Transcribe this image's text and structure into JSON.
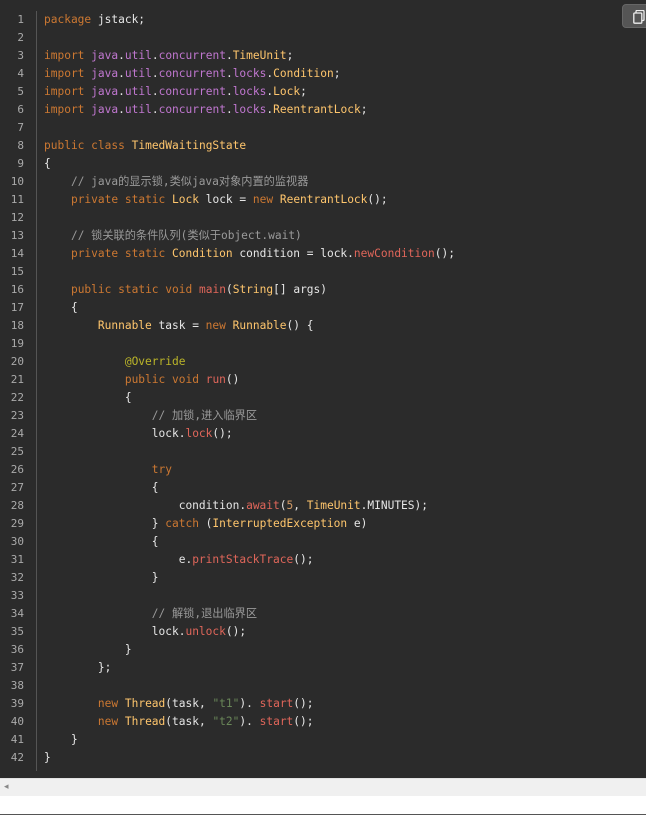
{
  "toolbar": {
    "copy_icon": "copy-icon"
  },
  "code_block": {
    "language": "java",
    "line_numbers": [
      "1",
      "2",
      "3",
      "4",
      "5",
      "6",
      "7",
      "8",
      "9",
      "10",
      "11",
      "12",
      "13",
      "14",
      "15",
      "16",
      "17",
      "18",
      "19",
      "20",
      "21",
      "22",
      "23",
      "24",
      "25",
      "26",
      "27",
      "28",
      "29",
      "30",
      "31",
      "32",
      "33",
      "34",
      "35",
      "36",
      "37",
      "38",
      "39",
      "40",
      "41",
      "42"
    ],
    "lines": [
      [
        [
          "kw",
          "package"
        ],
        [
          "plain",
          " jstack;"
        ]
      ],
      [],
      [
        [
          "kw",
          "import"
        ],
        [
          "plain",
          " "
        ],
        [
          "pkg",
          "java"
        ],
        [
          "plain",
          "."
        ],
        [
          "pkg",
          "util"
        ],
        [
          "plain",
          "."
        ],
        [
          "pkg",
          "concurrent"
        ],
        [
          "plain",
          "."
        ],
        [
          "cls",
          "TimeUnit"
        ],
        [
          "plain",
          ";"
        ]
      ],
      [
        [
          "kw",
          "import"
        ],
        [
          "plain",
          " "
        ],
        [
          "pkg",
          "java"
        ],
        [
          "plain",
          "."
        ],
        [
          "pkg",
          "util"
        ],
        [
          "plain",
          "."
        ],
        [
          "pkg",
          "concurrent"
        ],
        [
          "plain",
          "."
        ],
        [
          "pkg",
          "locks"
        ],
        [
          "plain",
          "."
        ],
        [
          "cls",
          "Condition"
        ],
        [
          "plain",
          ";"
        ]
      ],
      [
        [
          "kw",
          "import"
        ],
        [
          "plain",
          " "
        ],
        [
          "pkg",
          "java"
        ],
        [
          "plain",
          "."
        ],
        [
          "pkg",
          "util"
        ],
        [
          "plain",
          "."
        ],
        [
          "pkg",
          "concurrent"
        ],
        [
          "plain",
          "."
        ],
        [
          "pkg",
          "locks"
        ],
        [
          "plain",
          "."
        ],
        [
          "cls",
          "Lock"
        ],
        [
          "plain",
          ";"
        ]
      ],
      [
        [
          "kw",
          "import"
        ],
        [
          "plain",
          " "
        ],
        [
          "pkg",
          "java"
        ],
        [
          "plain",
          "."
        ],
        [
          "pkg",
          "util"
        ],
        [
          "plain",
          "."
        ],
        [
          "pkg",
          "concurrent"
        ],
        [
          "plain",
          "."
        ],
        [
          "pkg",
          "locks"
        ],
        [
          "plain",
          "."
        ],
        [
          "cls",
          "ReentrantLock"
        ],
        [
          "plain",
          ";"
        ]
      ],
      [],
      [
        [
          "kw",
          "public"
        ],
        [
          "plain",
          " "
        ],
        [
          "kw",
          "class"
        ],
        [
          "plain",
          " "
        ],
        [
          "cls",
          "TimedWaitingState"
        ]
      ],
      [
        [
          "plain",
          "{"
        ]
      ],
      [
        [
          "plain",
          "    "
        ],
        [
          "cmt",
          "// java的显示锁,类似java对象内置的监视器"
        ]
      ],
      [
        [
          "plain",
          "    "
        ],
        [
          "kw",
          "private"
        ],
        [
          "plain",
          " "
        ],
        [
          "kw",
          "static"
        ],
        [
          "plain",
          " "
        ],
        [
          "cls",
          "Lock"
        ],
        [
          "plain",
          " lock = "
        ],
        [
          "kw",
          "new"
        ],
        [
          "plain",
          " "
        ],
        [
          "cls",
          "ReentrantLock"
        ],
        [
          "plain",
          "();"
        ]
      ],
      [],
      [
        [
          "plain",
          "    "
        ],
        [
          "cmt",
          "// 锁关联的条件队列(类似于object.wait)"
        ]
      ],
      [
        [
          "plain",
          "    "
        ],
        [
          "kw",
          "private"
        ],
        [
          "plain",
          " "
        ],
        [
          "kw",
          "static"
        ],
        [
          "plain",
          " "
        ],
        [
          "cls",
          "Condition"
        ],
        [
          "plain",
          " condition = lock."
        ],
        [
          "fn",
          "newCondition"
        ],
        [
          "plain",
          "();"
        ]
      ],
      [],
      [
        [
          "plain",
          "    "
        ],
        [
          "kw",
          "public"
        ],
        [
          "plain",
          " "
        ],
        [
          "kw",
          "static"
        ],
        [
          "plain",
          " "
        ],
        [
          "kw",
          "void"
        ],
        [
          "plain",
          " "
        ],
        [
          "fn",
          "main"
        ],
        [
          "plain",
          "("
        ],
        [
          "cls",
          "String"
        ],
        [
          "plain",
          "[] args)"
        ]
      ],
      [
        [
          "plain",
          "    {"
        ]
      ],
      [
        [
          "plain",
          "        "
        ],
        [
          "cls",
          "Runnable"
        ],
        [
          "plain",
          " task = "
        ],
        [
          "kw",
          "new"
        ],
        [
          "plain",
          " "
        ],
        [
          "cls",
          "Runnable"
        ],
        [
          "plain",
          "() {"
        ]
      ],
      [],
      [
        [
          "plain",
          "            "
        ],
        [
          "ann",
          "@Override"
        ]
      ],
      [
        [
          "plain",
          "            "
        ],
        [
          "kw",
          "public"
        ],
        [
          "plain",
          " "
        ],
        [
          "kw",
          "void"
        ],
        [
          "plain",
          " "
        ],
        [
          "fn",
          "run"
        ],
        [
          "plain",
          "()"
        ]
      ],
      [
        [
          "plain",
          "            {"
        ]
      ],
      [
        [
          "plain",
          "                "
        ],
        [
          "cmt",
          "// 加锁,进入临界区"
        ]
      ],
      [
        [
          "plain",
          "                lock."
        ],
        [
          "fn",
          "lock"
        ],
        [
          "plain",
          "();"
        ]
      ],
      [],
      [
        [
          "plain",
          "                "
        ],
        [
          "kw",
          "try"
        ]
      ],
      [
        [
          "plain",
          "                {"
        ]
      ],
      [
        [
          "plain",
          "                    condition."
        ],
        [
          "fn",
          "await"
        ],
        [
          "plain",
          "("
        ],
        [
          "num",
          "5"
        ],
        [
          "plain",
          ", "
        ],
        [
          "cls",
          "TimeUnit"
        ],
        [
          "plain",
          ".MINUTES);"
        ]
      ],
      [
        [
          "plain",
          "                } "
        ],
        [
          "kw",
          "catch"
        ],
        [
          "plain",
          " ("
        ],
        [
          "cls",
          "InterruptedException"
        ],
        [
          "plain",
          " e)"
        ]
      ],
      [
        [
          "plain",
          "                {"
        ]
      ],
      [
        [
          "plain",
          "                    e."
        ],
        [
          "fn",
          "printStackTrace"
        ],
        [
          "plain",
          "();"
        ]
      ],
      [
        [
          "plain",
          "                }"
        ]
      ],
      [],
      [
        [
          "plain",
          "                "
        ],
        [
          "cmt",
          "// 解锁,退出临界区"
        ]
      ],
      [
        [
          "plain",
          "                lock."
        ],
        [
          "fn",
          "unlock"
        ],
        [
          "plain",
          "();"
        ]
      ],
      [
        [
          "plain",
          "            }"
        ]
      ],
      [
        [
          "plain",
          "        };"
        ]
      ],
      [],
      [
        [
          "plain",
          "        "
        ],
        [
          "kw",
          "new"
        ],
        [
          "plain",
          " "
        ],
        [
          "cls",
          "Thread"
        ],
        [
          "plain",
          "(task, "
        ],
        [
          "str",
          "\"t1\""
        ],
        [
          "plain",
          "). "
        ],
        [
          "fn",
          "start"
        ],
        [
          "plain",
          "();"
        ]
      ],
      [
        [
          "plain",
          "        "
        ],
        [
          "kw",
          "new"
        ],
        [
          "plain",
          " "
        ],
        [
          "cls",
          "Thread"
        ],
        [
          "plain",
          "(task, "
        ],
        [
          "str",
          "\"t2\""
        ],
        [
          "plain",
          "). "
        ],
        [
          "fn",
          "start"
        ],
        [
          "plain",
          "();"
        ]
      ],
      [
        [
          "plain",
          "    }"
        ]
      ],
      [
        [
          "plain",
          "}"
        ]
      ]
    ]
  },
  "scrollbar": {
    "left_arrow": "◂"
  },
  "colors": {
    "background": "#2b2b2b",
    "keyword": "#cc7832",
    "class": "#ffc66d",
    "package": "#c077d0",
    "method": "#e0665a",
    "string": "#6a8759",
    "number": "#d19a66",
    "comment": "#9a9a9a",
    "annotation": "#bbb529"
  }
}
